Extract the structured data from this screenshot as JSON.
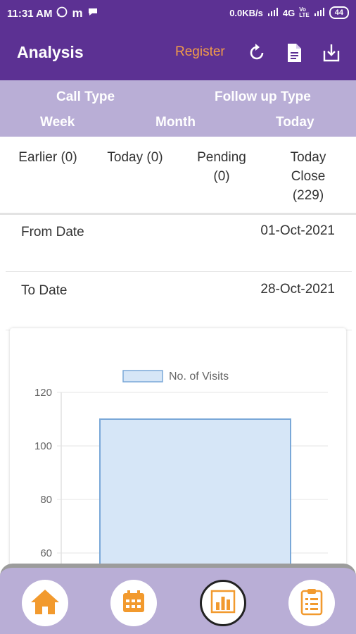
{
  "status_bar": {
    "time": "11:31 AM",
    "network_speed": "0.0KB/s",
    "network_type": "4G",
    "battery": "44"
  },
  "app_bar": {
    "title": "Analysis",
    "register_label": "Register",
    "icons": [
      "refresh-icon",
      "document-icon",
      "download-icon"
    ]
  },
  "tabs": {
    "row1": [
      "Call Type",
      "Follow up Type"
    ],
    "row2": [
      "Week",
      "Month",
      "Today"
    ]
  },
  "counts": [
    {
      "line1": "Earlier (0)",
      "line2": ""
    },
    {
      "line1": "Today (0)",
      "line2": ""
    },
    {
      "line1": "Pending",
      "line2": "(0)"
    },
    {
      "line1": "Today",
      "line2": "Close",
      "line3": "(229)"
    }
  ],
  "date_filters": {
    "from_label": "From Date",
    "from_value": "01-Oct-2021",
    "to_label": "To Date",
    "to_value": "28-Oct-2021"
  },
  "chart_data": {
    "type": "bar",
    "series": [
      {
        "name": "No. of Visits",
        "values": [
          110
        ]
      }
    ],
    "categories": [
      ""
    ],
    "y_ticks": [
      "120",
      "100",
      "80",
      "60"
    ],
    "ylim": [
      0,
      120
    ],
    "grid": true,
    "legend": "top",
    "colors": {
      "bar_fill": "#d6e6f7",
      "bar_stroke": "#7aa8d8"
    }
  },
  "bottom_nav": {
    "items": [
      "home-icon",
      "calendar-icon",
      "chart-icon",
      "clipboard-icon"
    ],
    "active": "chart-icon",
    "accent": "#f29a2e"
  },
  "colors": {
    "primary": "#5c3193",
    "secondary": "#b9aed6",
    "accent": "#f29c48"
  }
}
